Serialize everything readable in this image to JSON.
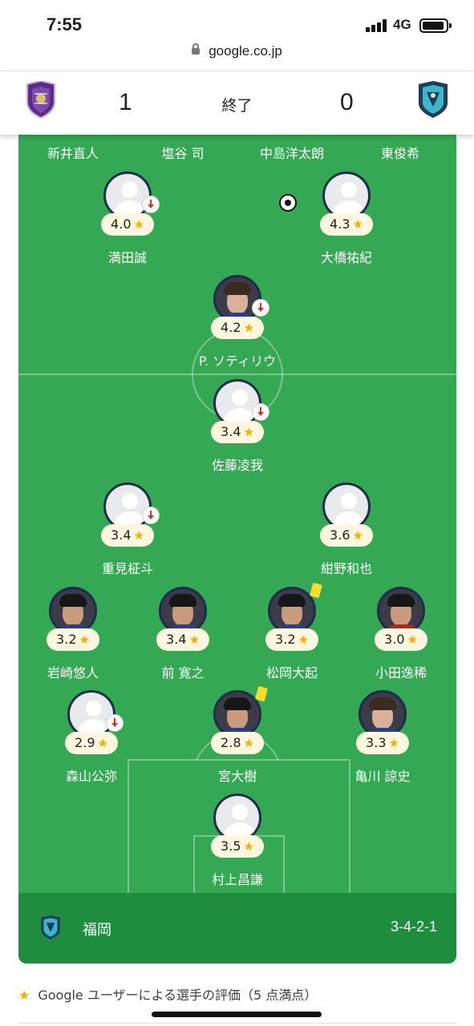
{
  "status_bar": {
    "time": "7:55",
    "network": "4G"
  },
  "browser": {
    "url": "google.co.jp"
  },
  "match": {
    "home_score": "1",
    "status": "終了",
    "away_score": "0",
    "home_crest_icon": "sanfrecce-crest-icon",
    "away_crest_icon": "avispa-crest-icon"
  },
  "substitutes_row": [
    "新井直人",
    "塩谷 司",
    "中島洋太朗",
    "東俊希"
  ],
  "players": [
    {
      "name": "満田誠",
      "rating": "4.0",
      "avatar": "placeholder",
      "subbed_off": true
    },
    {
      "name": "大橋祐紀",
      "rating": "4.3",
      "avatar": "placeholder",
      "goal": true
    },
    {
      "name": "P. ソティリウ",
      "rating": "4.2",
      "avatar": "photo",
      "subbed_off": true
    },
    {
      "name": "佐藤凌我",
      "rating": "3.4",
      "avatar": "placeholder",
      "subbed_off": true
    },
    {
      "name": "重見柾斗",
      "rating": "3.4",
      "avatar": "placeholder",
      "subbed_off": true
    },
    {
      "name": "紺野和也",
      "rating": "3.6",
      "avatar": "placeholder"
    },
    {
      "name": "岩崎悠人",
      "rating": "3.2",
      "avatar": "photo"
    },
    {
      "name": "前 寛之",
      "rating": "3.4",
      "avatar": "photo"
    },
    {
      "name": "松岡大起",
      "rating": "3.2",
      "avatar": "photo",
      "yellow_card": true
    },
    {
      "name": "小田逸稀",
      "rating": "3.0",
      "avatar": "photo"
    },
    {
      "name": "森山公弥",
      "rating": "2.9",
      "avatar": "placeholder",
      "subbed_off": true
    },
    {
      "name": "宮大樹",
      "rating": "2.8",
      "avatar": "photo",
      "yellow_card": true
    },
    {
      "name": "亀川 諒史",
      "rating": "3.3",
      "avatar": "photo"
    },
    {
      "name": "村上昌謙",
      "rating": "3.5",
      "avatar": "placeholder"
    }
  ],
  "team": {
    "name": "福岡",
    "formation": "3-4-2-1"
  },
  "footer": {
    "text": "Google ユーザーによる選手の評価（5 点満点）"
  },
  "colors": {
    "pitch": "#34a853",
    "team_bar": "#1e8e3e",
    "rating_bg": "#fef7e0",
    "star": "#f9ab00",
    "yellow_card": "#fbdc2c",
    "sub_arrow": "#d93025"
  }
}
